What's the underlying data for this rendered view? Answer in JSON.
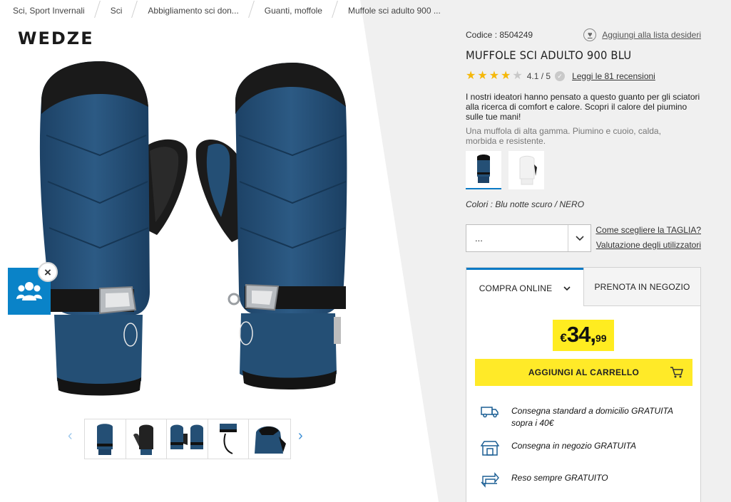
{
  "breadcrumb": [
    "Sci, Sport Invernali",
    "Sci",
    "Abbigliamento sci don...",
    "Guanti, moffole",
    "Muffole sci adulto 900 ..."
  ],
  "brand": "WEDZE",
  "product": {
    "code_label": "Codice : 8504249",
    "wishlist_label": "Aggiungi alla lista desideri",
    "title": "MUFFOLE SCI ADULTO 900 BLU",
    "rating": 4.1,
    "rating_text": "4.1 / 5",
    "reviews_link": "Leggi le 81 recensioni",
    "description": "I nostri ideatori hanno pensato a questo guanto per gli sciatori alla ricerca di comfort e calore. Scopri il calore del piumino sulle tue mani!",
    "subdescription": "Una muffola di alta gamma. Piumino e cuoio, calda, morbida e resistente.",
    "colors_label": "Colori : Blu notte scuro / NERO"
  },
  "size": {
    "select_value": "...",
    "guide_link": "Come scegliere la TAGLIA?",
    "reviews_link": "Valutazione degli utilizzatori"
  },
  "purchase": {
    "tab_online": "COMPRA ONLINE",
    "tab_store": "PRENOTA IN NEGOZIO",
    "price_currency": "€",
    "price_int": "34,",
    "price_cents": "99",
    "add_to_cart": "AGGIUNGI AL CARRELLO"
  },
  "delivery": [
    {
      "text": "Consegna standard a domicilio GRATUITA sopra i 40€",
      "icon": "truck-icon"
    },
    {
      "text": "Consegna in negozio GRATUITA",
      "icon": "store-icon"
    },
    {
      "text": "Reso sempre GRATUITO",
      "icon": "return-icon"
    }
  ],
  "colors": {
    "accent": "#0a7ac5",
    "price_bg": "#ffec20",
    "glove_blue": "#244f75",
    "widget_blue": "#0a83c8"
  }
}
